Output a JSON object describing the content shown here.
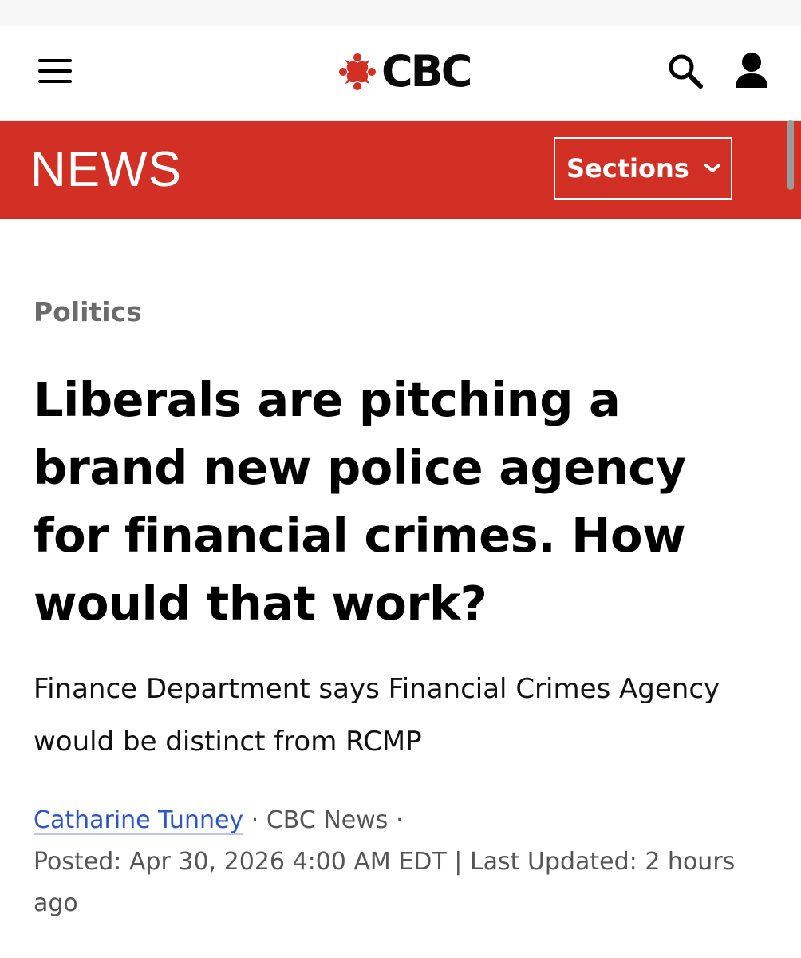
{
  "header": {
    "brand_name": "CBC",
    "brand_color": "#d22f25",
    "menu_icon": "hamburger-menu-icon",
    "search_icon": "search-icon",
    "account_icon": "user-account-icon"
  },
  "newsbar": {
    "label": "NEWS",
    "sections_label": "Sections",
    "sections_icon": "chevron-down-icon",
    "background_color": "#d22f25"
  },
  "article": {
    "category": "Politics",
    "headline": "Liberals are pitching a brand new police agency for financial crimes. How would that work?",
    "deck": "Finance Department says Financial Crimes Agency would be distinct from RCMP",
    "byline": {
      "author": "Catharine Tunney",
      "separator": "·",
      "source": "CBC News",
      "posted_label": "Posted:",
      "posted_date": "Apr 30, 2026 4:00 AM EDT",
      "divider": "|",
      "updated_label": "Last Updated:",
      "updated_value": "2 hours ago",
      "link_color": "#2c55c9"
    }
  }
}
